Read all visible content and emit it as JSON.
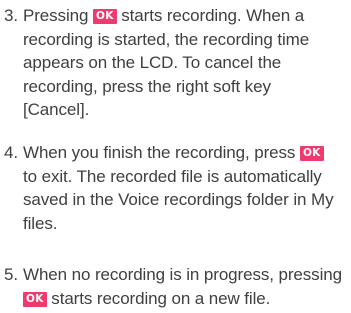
{
  "key_label": "OK",
  "key_color": "#ee3a6e",
  "steps": [
    {
      "number": "3.",
      "lines": [
        {
          "before": "Pressing ",
          "after": " starts recording. When a"
        },
        {
          "text": "recording is started, the recording time"
        },
        {
          "text": "appears on the LCD. To cancel the"
        },
        {
          "text": "recording, press the right soft key"
        },
        {
          "text": "[Cancel]."
        }
      ]
    },
    {
      "number": "4.",
      "lines": [
        {
          "before": "When you finish the recording, press "
        },
        {
          "text": "to exit. The recorded file is automatically"
        },
        {
          "text": "saved in the Voice recordings folder in My"
        },
        {
          "text": "files."
        }
      ]
    },
    {
      "number": "5.",
      "lines": [
        {
          "text": "When no recording is in progress, pressing"
        },
        {
          "after": " starts recording on a new file."
        }
      ]
    }
  ]
}
